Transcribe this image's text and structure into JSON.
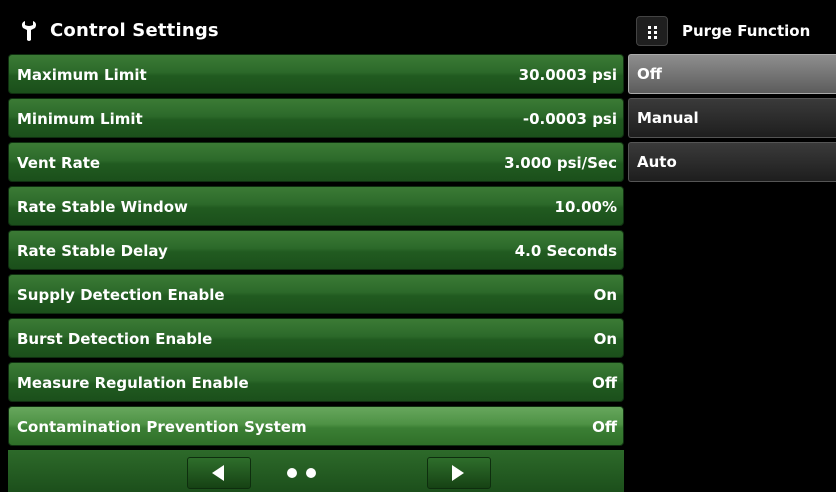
{
  "header": {
    "title": "Control Settings",
    "icon": "wrench-icon"
  },
  "settings": [
    {
      "label": "Maximum Limit",
      "value": "30.0003 psi"
    },
    {
      "label": "Minimum Limit",
      "value": "-0.0003 psi"
    },
    {
      "label": "Vent Rate",
      "value": "3.000 psi/Sec"
    },
    {
      "label": "Rate Stable Window",
      "value": "10.00%"
    },
    {
      "label": "Rate Stable Delay",
      "value": "4.0 Seconds"
    },
    {
      "label": "Supply Detection Enable",
      "value": "On"
    },
    {
      "label": "Burst Detection Enable",
      "value": "On"
    },
    {
      "label": "Measure Regulation Enable",
      "value": "Off"
    },
    {
      "label": "Contamination Prevention System",
      "value": "Off"
    }
  ],
  "footer": {
    "prev_icon": "arrow-left-icon",
    "next_icon": "arrow-right-icon",
    "page_count": 2,
    "current_page": 1
  },
  "panel": {
    "title": "Purge Function",
    "menu_icon": "grid-menu-icon",
    "options": [
      "Off",
      "Manual",
      "Auto"
    ],
    "selected": "Off"
  }
}
